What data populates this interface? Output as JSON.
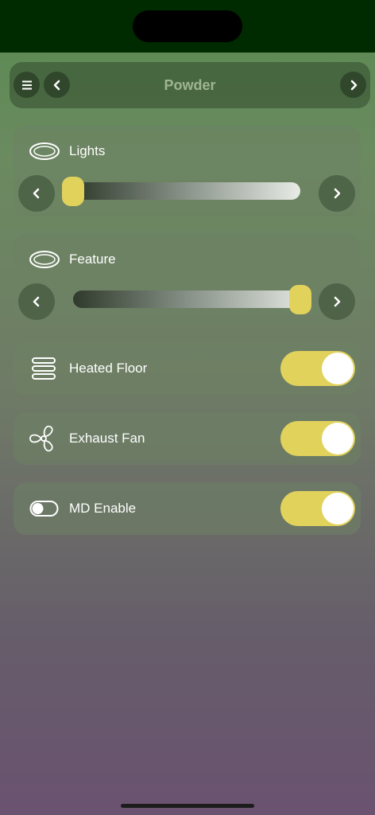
{
  "header": {
    "title": "Powder"
  },
  "colors": {
    "accent": "#e1d25c",
    "status_bar": "#002a00"
  },
  "icons": {
    "menu": "menu-icon",
    "prev": "chevron-left-icon",
    "next": "chevron-right-icon",
    "light": "ceiling-light-icon",
    "floor": "heated-floor-icon",
    "fan": "fan-icon",
    "switch": "switch-icon"
  },
  "dimmers": [
    {
      "label": "Lights",
      "level": 0.0
    },
    {
      "label": "Feature",
      "level": 1.0
    }
  ],
  "switches": [
    {
      "label": "Heated Floor",
      "on": true
    },
    {
      "label": "Exhaust Fan",
      "on": true
    },
    {
      "label": "MD Enable",
      "on": true
    }
  ]
}
